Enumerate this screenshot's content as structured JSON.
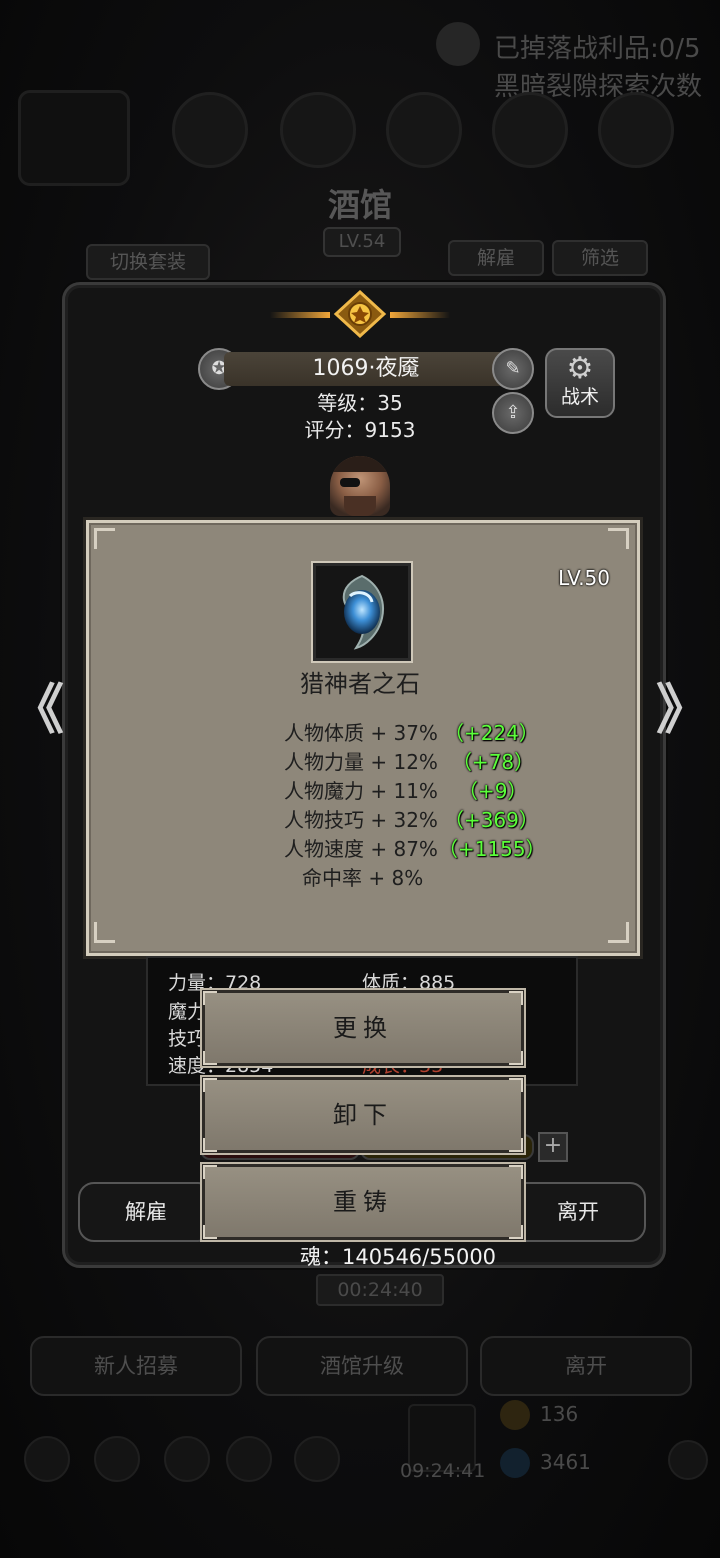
{
  "background": {
    "loot_text": "已掉落战利品:0/5",
    "rift_text": "黑暗裂隙探索次数",
    "tavern_title": "酒馆",
    "tavern_level": "LV.54",
    "switch_set": "切换套装",
    "dismiss_tab": "解雇",
    "filter_tab": "筛选",
    "bottom_buttons": [
      "新人招募",
      "酒馆升级",
      "离开"
    ],
    "currency_a": "136",
    "currency_b": "3461",
    "clock": "09:24:41",
    "timer": "00:24:40"
  },
  "hero": {
    "name": "1069·夜魇",
    "level_line": "等级：35",
    "score_line": "评分：9153",
    "tactics_label": "战术"
  },
  "item": {
    "name": "猎神者之石",
    "level": "LV.50",
    "stats": [
      {
        "text": "人物体质 + 37%",
        "bonus": "（+224）"
      },
      {
        "text": "人物力量 + 12%",
        "bonus": "（+78）"
      },
      {
        "text": "人物魔力 + 11%",
        "bonus": "（+9）"
      },
      {
        "text": "人物技巧 + 32%",
        "bonus": "（+369）"
      },
      {
        "text": "人物速度 + 87%",
        "bonus": "（+1155）"
      },
      {
        "text": "命中率 + 8%",
        "bonus": ""
      }
    ]
  },
  "attributes": {
    "strength": "力量：728",
    "constitution": "体质：885",
    "magic_partial": "魔力",
    "skill_partial": "技巧",
    "speed_partial": "速度：2854",
    "growth_partial": "成长：33"
  },
  "menu": {
    "replace": "更换",
    "unequip": "卸下",
    "reforge": "重铸"
  },
  "actions": {
    "dismiss": "解雇",
    "leave": "离开"
  },
  "soul": "魂：140546/55000",
  "colors": {
    "bonus_green": "#5bff3a",
    "card_bg": "#8e877a",
    "menu_bg": "#8a8376"
  }
}
